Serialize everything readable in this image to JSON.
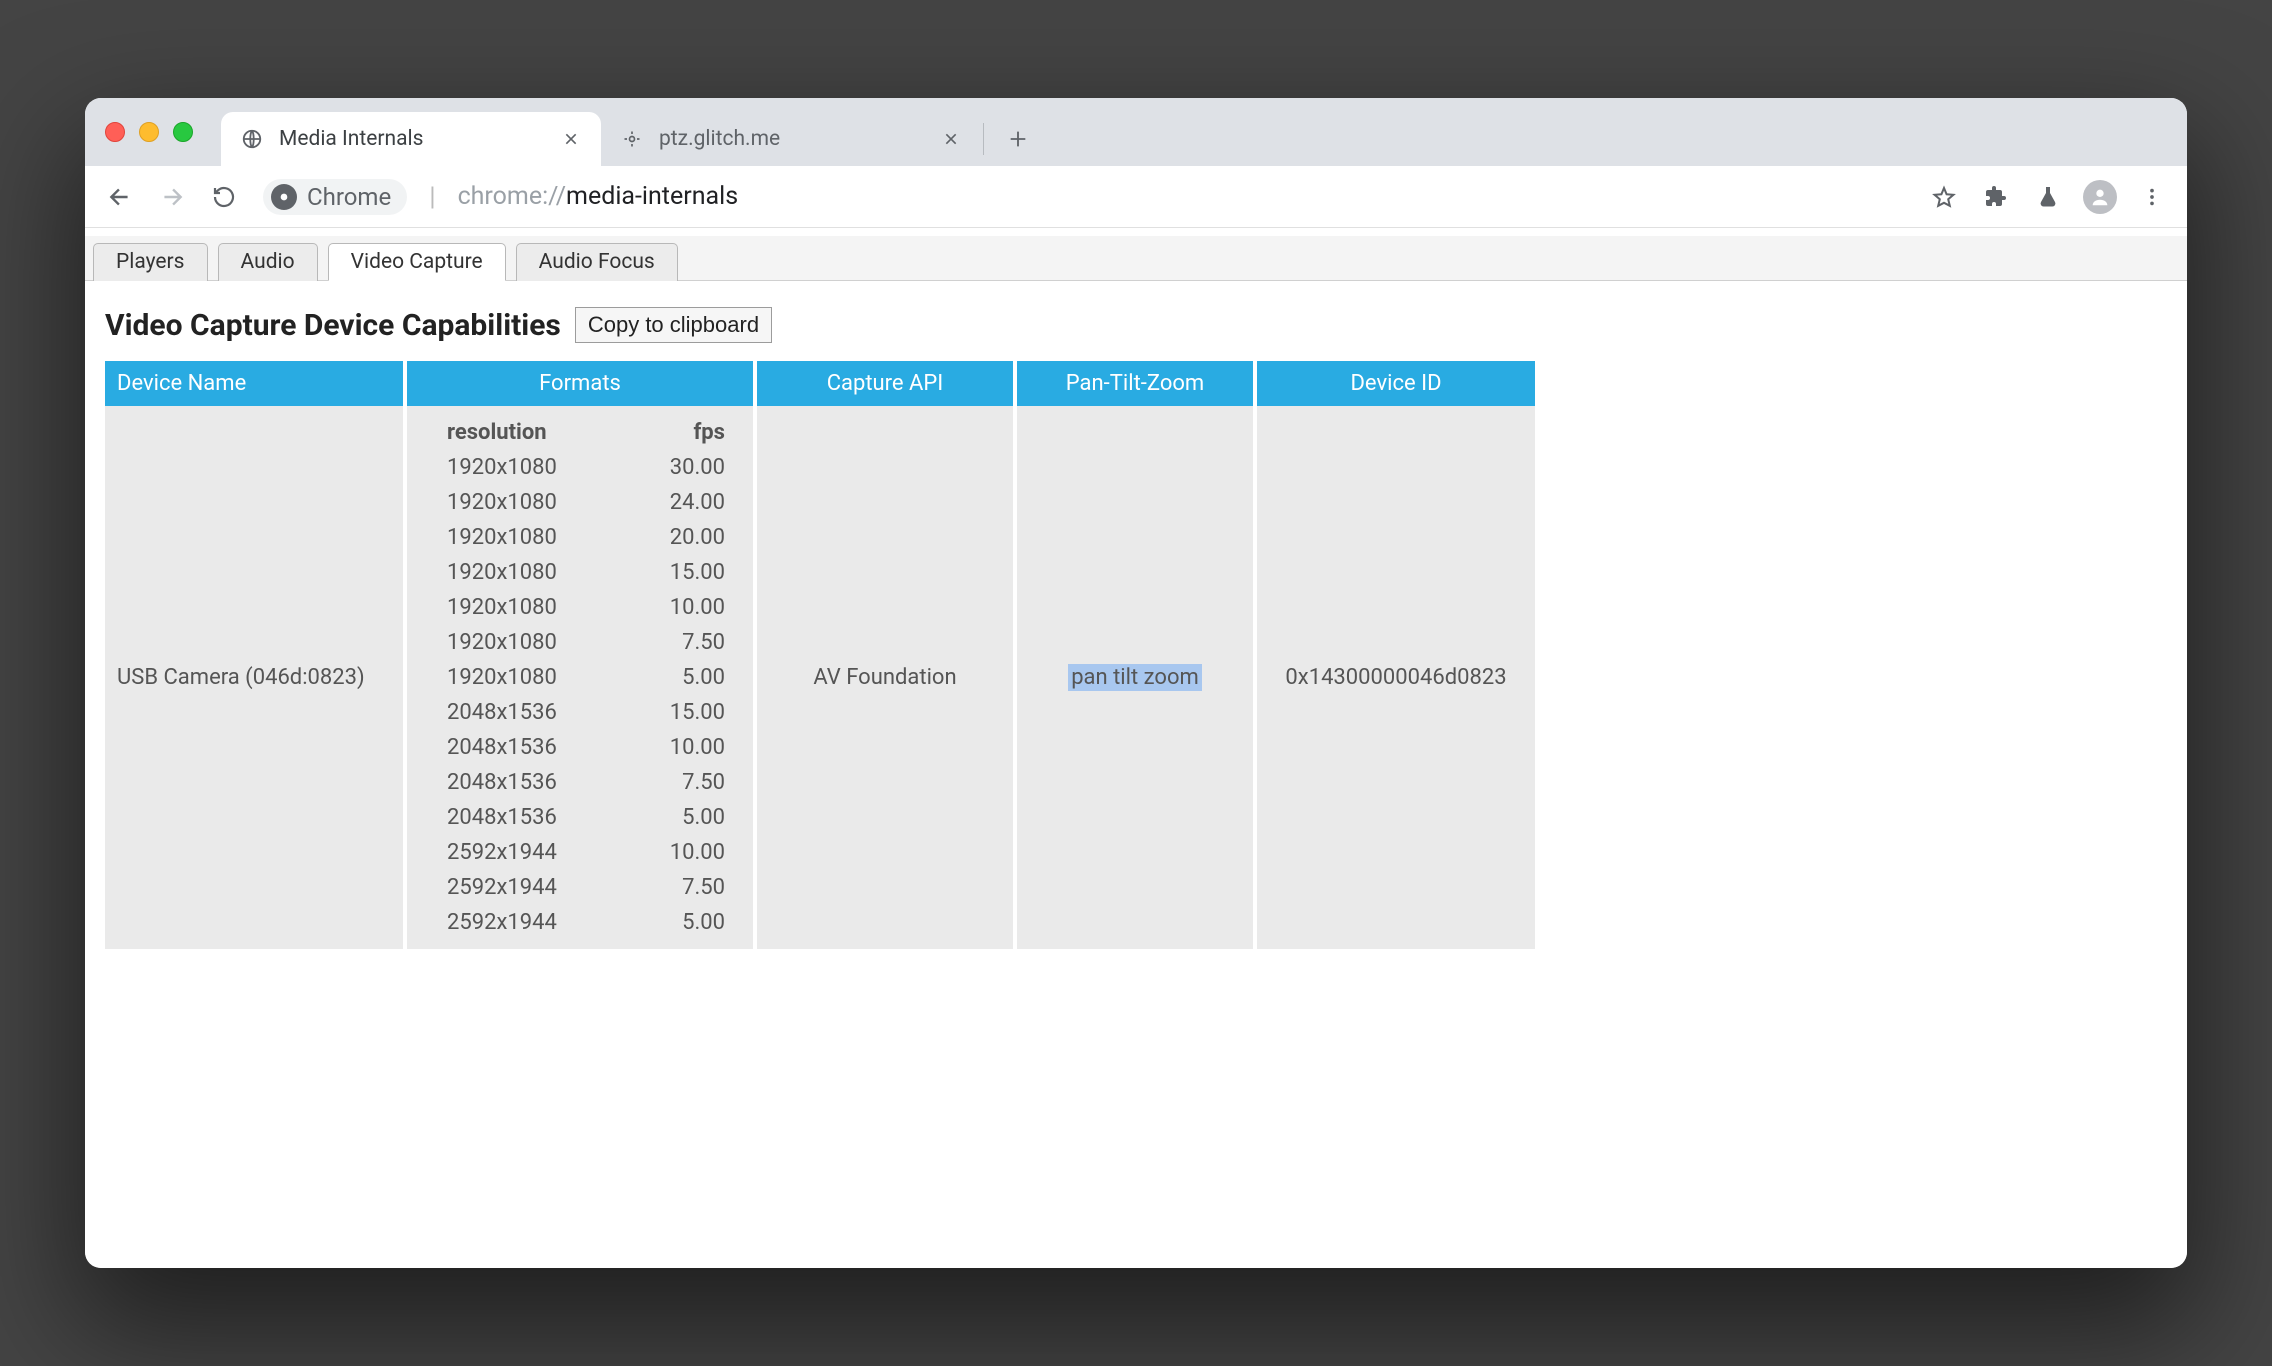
{
  "browser": {
    "tabs": [
      {
        "title": "Media Internals",
        "active": true
      },
      {
        "title": "ptz.glitch.me",
        "active": false
      }
    ],
    "url_chip": "Chrome",
    "url_prefix": "chrome://",
    "url_path": "media-internals"
  },
  "page": {
    "tabs": [
      "Players",
      "Audio",
      "Video Capture",
      "Audio Focus"
    ],
    "active_tab": 2,
    "title": "Video Capture Device Capabilities",
    "copy_button": "Copy to clipboard",
    "headers": [
      "Device Name",
      "Formats",
      "Capture API",
      "Pan-Tilt-Zoom",
      "Device ID"
    ],
    "format_headers": {
      "res": "resolution",
      "fps": "fps"
    },
    "device": {
      "name": "USB Camera (046d:0823)",
      "capture_api": "AV Foundation",
      "ptz": "pan tilt zoom",
      "id": "0x14300000046d0823",
      "formats": [
        {
          "res": "1920x1080",
          "fps": "30.00"
        },
        {
          "res": "1920x1080",
          "fps": "24.00"
        },
        {
          "res": "1920x1080",
          "fps": "20.00"
        },
        {
          "res": "1920x1080",
          "fps": "15.00"
        },
        {
          "res": "1920x1080",
          "fps": "10.00"
        },
        {
          "res": "1920x1080",
          "fps": "7.50"
        },
        {
          "res": "1920x1080",
          "fps": "5.00"
        },
        {
          "res": "2048x1536",
          "fps": "15.00"
        },
        {
          "res": "2048x1536",
          "fps": "10.00"
        },
        {
          "res": "2048x1536",
          "fps": "7.50"
        },
        {
          "res": "2048x1536",
          "fps": "5.00"
        },
        {
          "res": "2592x1944",
          "fps": "10.00"
        },
        {
          "res": "2592x1944",
          "fps": "7.50"
        },
        {
          "res": "2592x1944",
          "fps": "5.00"
        }
      ]
    }
  }
}
